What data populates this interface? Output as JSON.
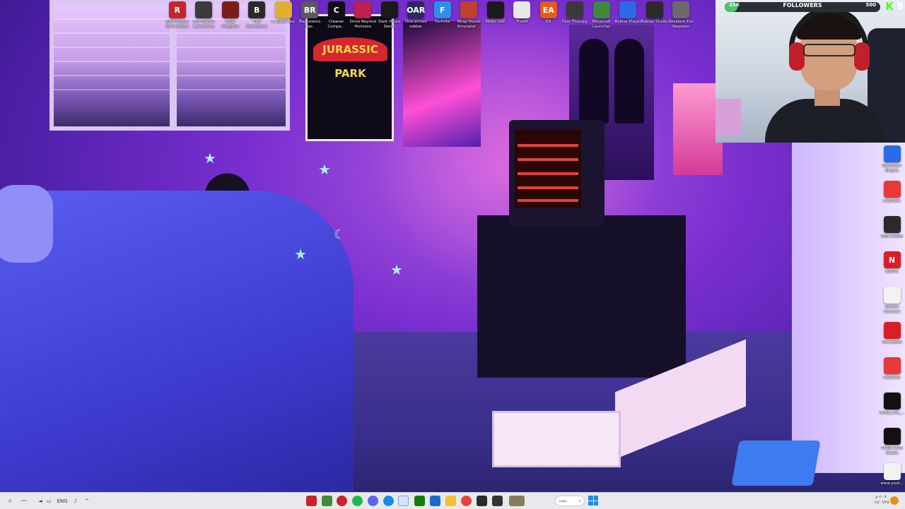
{
  "desktop_icons_top": [
    {
      "label": "RISK Global Domination",
      "glyph": "R",
      "color": "#c8232c"
    },
    {
      "label": "SCP Secret Laboratory",
      "glyph": "",
      "color": "#3b3b3b"
    },
    {
      "label": "Fatal Kingdom",
      "glyph": "",
      "color": "#7a1c1c"
    },
    {
      "label": "The Bonesboro",
      "glyph": "B",
      "color": "#2a2a2a"
    },
    {
      "label": "It Takes Two",
      "glyph": "",
      "color": "#e0b030"
    },
    {
      "label": "Backrooms Rec.",
      "glyph": "BR",
      "color": "#5a5a5a"
    },
    {
      "label": "Cleaner Compa...",
      "glyph": "C",
      "color": "#101010"
    },
    {
      "label": "Drive Beyond Horizons",
      "glyph": "",
      "color": "#c02050"
    },
    {
      "label": "Dark Hours Demo",
      "glyph": "",
      "color": "#1a1a1a"
    },
    {
      "label": "One-armed robber",
      "glyph": "OAR",
      "color": "#2a2a5a"
    },
    {
      "label": "Fortnite",
      "glyph": "F",
      "color": "#2f8fe8"
    },
    {
      "label": "Wrap House Simulator ...",
      "glyph": "",
      "color": "#c04030"
    },
    {
      "label": "PANICORE",
      "glyph": "",
      "color": "#1a1a1a"
    },
    {
      "label": "FiveM",
      "glyph": "",
      "color": "#e8e8e8"
    },
    {
      "label": "EA",
      "glyph": "EA",
      "color": "#e85a1a"
    },
    {
      "label": "Fear Therapy",
      "glyph": "",
      "color": "#3a3a3a"
    },
    {
      "label": "Minecraft Launcher",
      "glyph": "",
      "color": "#3e8a3a"
    },
    {
      "label": "Roblox Player",
      "glyph": "",
      "color": "#2a6ae8"
    },
    {
      "label": "Roblox Studio",
      "glyph": "",
      "color": "#2a2a2a"
    },
    {
      "label": "Resident Evil Requiem",
      "glyph": "",
      "color": "#6a6a6a"
    }
  ],
  "desktop_icons_right": [
    {
      "label": "Wallpaper Engine",
      "glyph": "",
      "color": "#2a6ae8"
    },
    {
      "label": "AnyDesk",
      "glyph": "",
      "color": "#e8393a"
    },
    {
      "label": "OBS Studio",
      "glyph": "",
      "color": "#2a2a2a"
    },
    {
      "label": "Netflix",
      "glyph": "N",
      "color": "#d81f26"
    },
    {
      "label": "Ubisoft Connect",
      "glyph": "",
      "color": "#f2f2f2"
    },
    {
      "label": "Soundpad",
      "glyph": "",
      "color": "#d81f26"
    },
    {
      "label": "AnyDesk",
      "glyph": "",
      "color": "#e8393a"
    },
    {
      "label": "tiktok_live_...",
      "glyph": "",
      "color": "#111111"
    },
    {
      "label": "TikTok LIVE Studio",
      "glyph": "",
      "color": "#111111"
    },
    {
      "label": "www.yout...",
      "glyph": "",
      "color": "#f2f2f2"
    }
  ],
  "overlay": {
    "followers_start": "256",
    "followers_label": "FOLLOWERS",
    "followers_goal": "500",
    "followers_progress": 0.08,
    "kick_logo": "K",
    "viewer_count": "9"
  },
  "taskbar": {
    "language": "ENG",
    "search_text": "بحث",
    "clock_time": "٤:٠٧ م",
    "clock_date": "١٤/٠٦/٢٥"
  },
  "colors": {
    "accent": "#1d8ae8",
    "follow_fill": "#4ec46a",
    "kick_green": "#53fc18"
  }
}
